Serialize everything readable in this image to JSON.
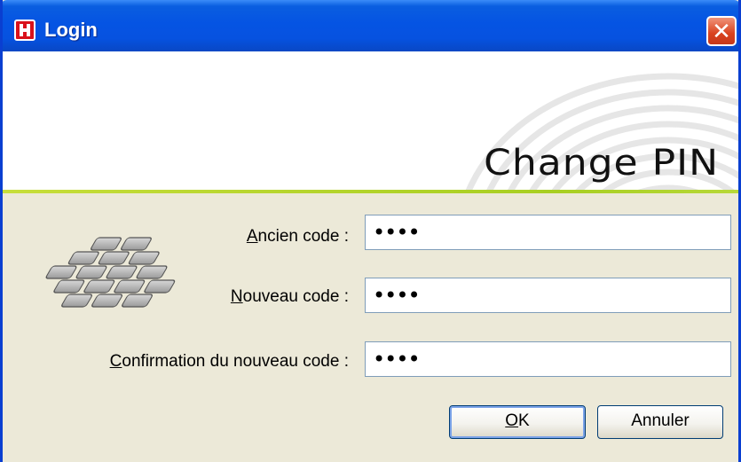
{
  "window": {
    "title": "Login",
    "close_symbol": "✕",
    "icon": "app-h-logo-icon"
  },
  "banner": {
    "title": "Change PIN"
  },
  "form": {
    "old_code": {
      "label_accel": "A",
      "label_rest": "ncien code :",
      "value": "••••"
    },
    "new_code": {
      "label_accel": "N",
      "label_rest": "ouveau code :",
      "value": "••••"
    },
    "confirm_code": {
      "label_accel": "C",
      "label_rest": "onfirmation du nouveau code :",
      "value": "••••"
    }
  },
  "buttons": {
    "ok_accel": "O",
    "ok_rest": "K",
    "cancel": "Annuler"
  },
  "colors": {
    "titlebar": "#0554e3",
    "close": "#d9421e",
    "accent_line": "#b6d52e",
    "body": "#ece9d8"
  }
}
